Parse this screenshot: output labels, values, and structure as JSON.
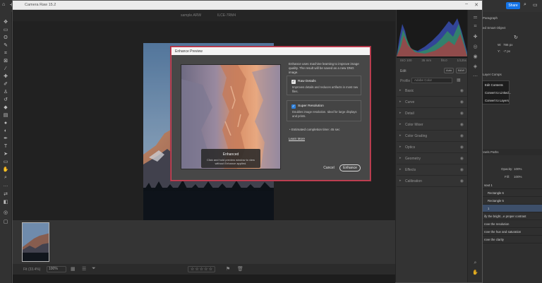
{
  "camera_raw": {
    "title": "Camera Raw 15.2",
    "filename": "sample.ARW",
    "camera": "ILCE-7RM4",
    "minimize_icon": "minimize-icon",
    "close_icon": "close-icon"
  },
  "histogram": {
    "exif": [
      "ISO 100",
      "35 mm",
      "f/8.0",
      "1/125s"
    ]
  },
  "panel": {
    "mode_label": "Edit",
    "mode_auto": "Auto",
    "mode_bw": "B&W",
    "profile_label": "Profile",
    "profile_value": "Adobe Color",
    "sections": [
      "Basic",
      "Curve",
      "Detail",
      "Color Mixer",
      "Color Grading",
      "Optics",
      "Geometry",
      "Effects",
      "Calibration"
    ]
  },
  "bottombar": {
    "fit": "Fit (33.4%)",
    "zoom": "100%",
    "stars": [
      "☆",
      "☆",
      "☆",
      "☆",
      "☆"
    ]
  },
  "dialog": {
    "title": "Enhance Preview",
    "description": "Enhance uses machine learning to improve image quality. The result will be saved as a new DNG image.",
    "raw_details_title": "Raw Details",
    "raw_details_desc": "Improves details and reduces artifacts in most raw files.",
    "super_res_title": "Super Resolution",
    "super_res_desc": "Doubles image resolution. Ideal for large displays and prints.",
    "time": "Estimated completion time: 45 sec",
    "learn_more": "Learn More",
    "cancel": "Cancel",
    "enhance": "Enhance",
    "preview_caption_title": "Enhanced",
    "preview_caption_text": "Click and hold preview window to view without Enhance applied."
  },
  "photoshop": {
    "share": "Share",
    "panel_tab": "Paragraph",
    "smart_object": "ed Smart Object",
    "w_label": "W:",
    "w_value": "786 px",
    "y_label": "Y:",
    "y_value": "-7 px",
    "layer_comps": "Layer Comps",
    "context_menu": [
      "Edit Contents",
      "Convert to Linked...",
      "Convert to Layers"
    ],
    "layers_tabs": "nnels   Paths",
    "opacity_label": "Opacity:",
    "opacity_value": "100%",
    "fill_label": "Fill:",
    "fill_value": "100%",
    "layers": [
      "sout 1",
      "Rectangle 6",
      "Rectangle 5",
      "1",
      "ify the bright...e proper contrast",
      "rove the resolution",
      "rove the hue and saturation",
      "rove the clarity"
    ]
  }
}
